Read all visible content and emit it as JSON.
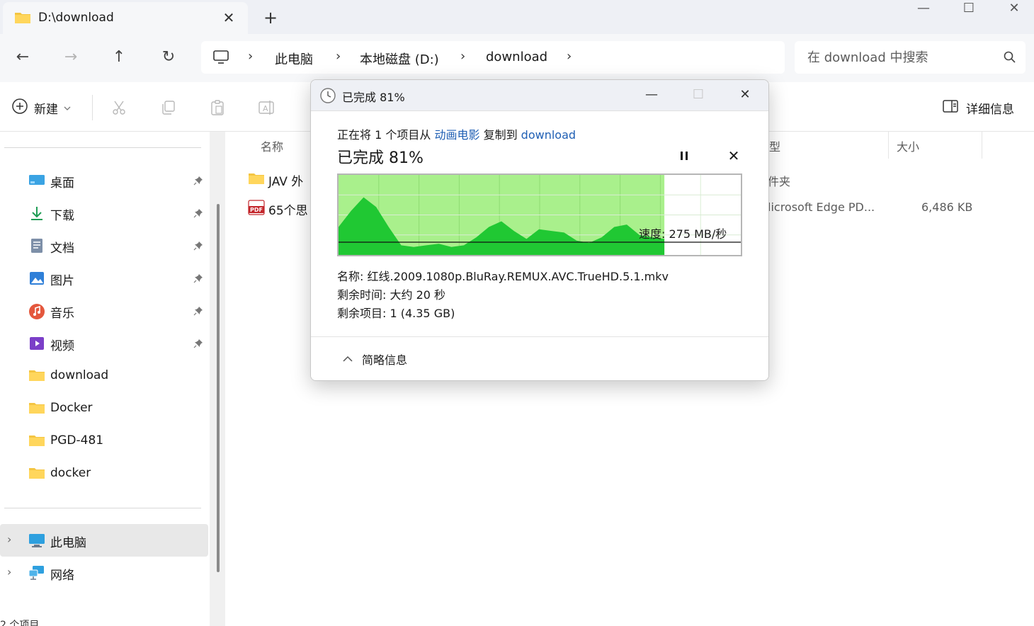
{
  "tab": {
    "title": "D:\\download",
    "close": "✕",
    "new_tab": "+"
  },
  "window": {
    "minimize": "—",
    "maximize": "☐",
    "close": "✕"
  },
  "nav": {
    "back": "←",
    "forward": "→",
    "up": "↑",
    "refresh": "↻"
  },
  "breadcrumb": {
    "items": [
      "此电脑",
      "本地磁盘 (D:)",
      "download"
    ],
    "sep": "›"
  },
  "search": {
    "placeholder": "在 download 中搜索"
  },
  "command_bar": {
    "new_label": "新建",
    "details_label": "详细信息"
  },
  "sidebar": {
    "quick": [
      {
        "label": "桌面",
        "icon": "desktop-icon"
      },
      {
        "label": "下载",
        "icon": "download-icon"
      },
      {
        "label": "文档",
        "icon": "document-icon"
      },
      {
        "label": "图片",
        "icon": "pictures-icon"
      },
      {
        "label": "音乐",
        "icon": "music-icon"
      },
      {
        "label": "视频",
        "icon": "video-icon"
      }
    ],
    "folders": [
      "download",
      "Docker",
      "PGD-481",
      "docker"
    ],
    "this_pc": "此电脑",
    "network": "网络",
    "chevron": "›"
  },
  "files": {
    "columns": {
      "name": "名称",
      "type": "型",
      "size": "大小"
    },
    "rows": [
      {
        "name": "JAV 外",
        "type": "件夹",
        "size": ""
      },
      {
        "name": "65个思",
        "type": "licrosoft Edge PD...",
        "size": "6,486 KB"
      }
    ]
  },
  "status_bar": {
    "text": "2 个项目"
  },
  "dialog": {
    "title": "已完成 81%",
    "copy_prefix": "正在将 1 个项目从",
    "source": "动画电影",
    "copy_mid": "复制到",
    "dest": "download",
    "percent_label": "已完成 81%",
    "progress_percent": 81,
    "speed_label": "速度: 275 MB/秒",
    "name_line": "名称: 红线.2009.1080p.BluRay.REMUX.AVC.TrueHD.5.1.mkv",
    "time_line": "剩余时间: 大约 20 秒",
    "items_line": "剩余项目: 1 (4.35 GB)",
    "collapse_label": "简略信息",
    "stop": "✕"
  },
  "colors": {
    "graph_fill_bg": "#a9f08c",
    "graph_area": "#20c833",
    "link": "#1f5fb4",
    "folder": "#f4c542"
  }
}
